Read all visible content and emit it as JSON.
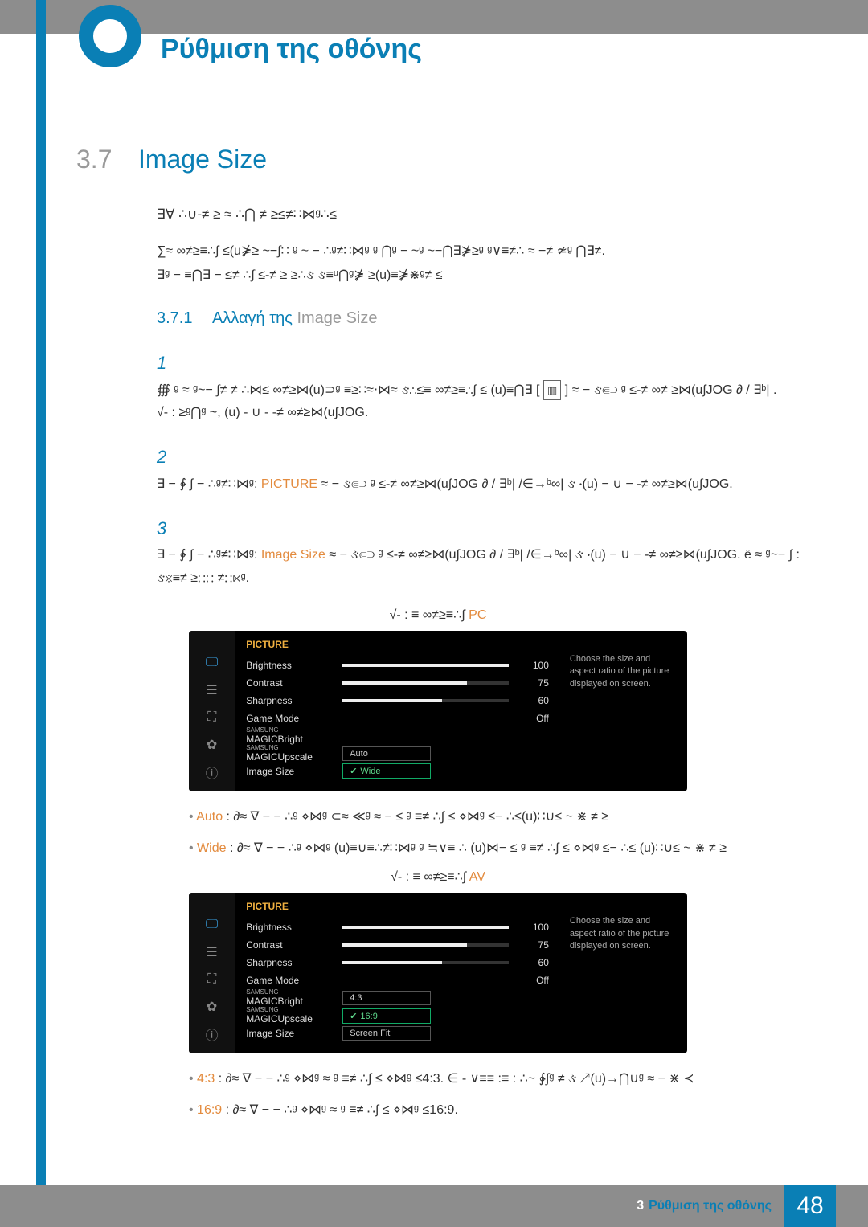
{
  "header": {
    "title": "Ρύθμιση της οθόνης"
  },
  "section": {
    "number": "3.7",
    "title": "Image Size"
  },
  "intro": "∃∀  ∴∪-≠ ≥ ≈  ∴⋂ ≠ ≥≤≠∷⋈ᵍ∴≤",
  "note": {
    "line1": "∑≈  ∞≠≥≡∴∫  ≤(u⋡≥  ~−∫∷  ᵍ  ~ − ∴ᵍ≠∷⋈ᵍ  ᵍ ⋂ᵍ −  ~ᵍ    ~−⋂∃⋡≥ᵍ  ᵍ∨≡≠∴   ≈ −≠  ≄ᵍ ⋂∃≠.",
    "line2": "∃ᵍ − ≡⋂∃   − ≤≠   ∴∫  ≤-≠ ≥  ≥∴ઙ  ઙ≡ᵘ⋂ᵍ⋡ ≥(u)≡⋡⋇ᵍ≠ ≤"
  },
  "subsection": {
    "number": "3.7.1",
    "title_a": "Αλλαγή της ",
    "title_b": "Image Size"
  },
  "steps": {
    "s1_num": "1",
    "s1_body_a": "∰   ᵍ  ≈   ᵍ~−   ∫≠ ≠   ∴⋈≤ ∞≠≥⋈(u)⊃ᵍ ≡≥∷≈⋅⋈≈  ઙ∴≤≡  ∞≠≥≡∴∫  ≤  (u)≡⋂∃ [",
    "s1_body_b": "] ≈ −  ઙ⋐⊃ ᵍ  ≤-≠  ∞≠ ≥⋈(u∫JOG  ∂ / ∃ᵇ| .",
    "s1_sub": "√- :   ≥ᵍ⋂ᵍ ~, (u) - ∪ -  -≠  ∞≠≥⋈(u∫JOG.",
    "s2_num": "2",
    "s2_body_a": "∃ −  ∳  ∫   − ∴ᵍ≠∷⋈ᵍ: ",
    "s2_body_b": " ≈ −  ઙ⋐⊃ ᵍ  ≤-≠  ∞≠≥⋈(u∫JOG  ∂ / ∃ᵇ| /∈→ᵇ∞|  ઙ ⋅(u) − ∪ −  -≠  ∞≠≥⋈(u∫JOG.",
    "s2_key": "PICTURE",
    "s3_num": "3",
    "s3_body_a": "∃ −  ∳  ∫   − ∴ᵍ≠∷⋈ᵍ: ",
    "s3_body_b": " ≈ −  ઙ⋐⊃ ᵍ  ≤-≠  ∞≠≥⋈(u∫JOG  ∂ / ∃ᵇ| /∈→ᵇ∞|  ઙ ⋅(u) − ∪ −  -≠  ∞≠≥⋈(u∫JOG. ё    ≈   ᵍ~−  ∫ :   ઙ⋇≡≠ ≥∷∷ ≠∷⋈ᵍ.",
    "s3_key": "Image Size"
  },
  "labels": {
    "pc": "√- : ≡  ∞≠≥≡∴∫  PC",
    "pc_key": "PC",
    "av": "√- : ≡  ∞≠≥≡∴∫  AV",
    "av_key": "AV"
  },
  "bullets": {
    "auto_k": "Auto",
    "auto_t": " : ∂≈   ∇ −  − ∴ᵍ  ⋄⋈ᵍ   ⊂≈ ≪ᵍ  ≈ − ≤  ᵍ ≡≠ ∴∫  ≤  ⋄⋈ᵍ ≤− ∴≤(u)∷∪≤  ~ ⋇ ≠ ≥",
    "wide_k": "Wide",
    "wide_t": " : ∂≈   ∇ −  − ∴ᵍ  ⋄⋈ᵍ   (u)≡∪≡∴≠∷⋈ᵍ  ᵍ ≒∨≡ ∴    (u)⋈− ≤  ᵍ ≡≠ ∴∫  ≤  ⋄⋈ᵍ ≤− ∴≤  (u)∷∪≤  ~ ⋇ ≠ ≥",
    "r43_k": "4:3",
    "r43_t": " : ∂≈   ∇ −  − ∴ᵍ  ⋄⋈ᵍ  ≈  ᵍ ≡≠ ∴∫  ≤  ⋄⋈ᵍ ≤4:3.  ∈ - ∨≡≡ :≡ :  ∴~ ∳∫ᵍ  ≠ ઙ  ↗(u)→⋂∪ᵍ  ≈ −   ⋇   ≺",
    "r169_k": "16:9",
    "r169_t": " : ∂≈   ∇ −  − ∴ᵍ  ⋄⋈ᵍ  ≈ ᵍ ≡≠ ∴∫  ≤  ⋄⋈ᵍ ≤16:9."
  },
  "osd": {
    "title": "PICTURE",
    "brightness": "Brightness",
    "brightness_v": "100",
    "contrast": "Contrast",
    "contrast_v": "75",
    "sharpness": "Sharpness",
    "sharpness_v": "60",
    "game": "Game Mode",
    "game_v": "Off",
    "magic_brand": "SAMSUNG",
    "magic": "MAGIC",
    "bright": "Bright",
    "upscale": "Upscale",
    "imgsize": "Image Size",
    "auto": "Auto",
    "wide": "Wide",
    "r43": "4:3",
    "r169": "16:9",
    "screenfit": "Screen Fit",
    "tip": "Choose the size and aspect ratio of the picture displayed on screen."
  },
  "footer": {
    "chapter_num": "3",
    "crumb": "Ρύθμιση της οθόνης",
    "page": "48"
  }
}
